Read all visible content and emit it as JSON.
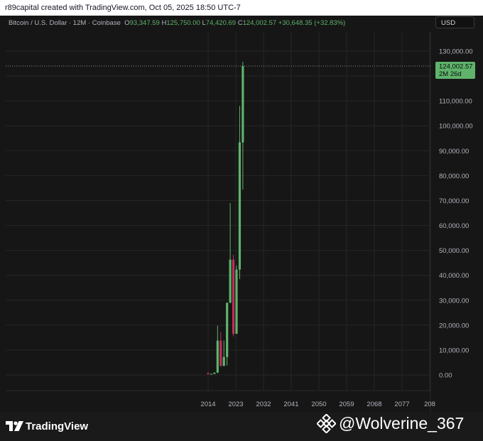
{
  "header": {
    "caption": "r89capital created with TradingView.com, Oct 05, 2025 18:50 UTC-7"
  },
  "legend": {
    "symbol": "Bitcoin / U.S. Dollar · 12M · Coinbase",
    "o_label": "O",
    "o_value": "93,347.59",
    "h_label": "H",
    "h_value": "125,750.00",
    "l_label": "L",
    "l_value": "74,420.69",
    "c_label": "C",
    "c_value": "124,002.57",
    "change": "+30,648.35 (+32.83%)"
  },
  "currency_button": "USD",
  "price_tag": {
    "price": "124,002.57",
    "countdown": "2M 26d"
  },
  "colors": {
    "up": "#5fb36b",
    "down": "#c02f5d",
    "tag_bg": "#5fb36b",
    "grid": "#262626"
  },
  "chart_data": {
    "type": "candlestick",
    "title": "Bitcoin / U.S. Dollar · 12M · Coinbase",
    "y_ticks": [
      "130,000.00",
      "110,000.00",
      "100,000.00",
      "90,000.00",
      "80,000.00",
      "70,000.00",
      "60,000.00",
      "50,000.00",
      "40,000.00",
      "30,000.00",
      "20,000.00",
      "10,000.00",
      "0.00"
    ],
    "x_ticks": [
      "2014",
      "2023",
      "2032",
      "2041",
      "2050",
      "2059",
      "2068",
      "2077",
      "208"
    ],
    "ylim": [
      -8000,
      140000
    ],
    "candles": [
      {
        "year": 2014,
        "open": 750,
        "high": 1000,
        "low": 170,
        "close": 320
      },
      {
        "year": 2015,
        "open": 320,
        "high": 500,
        "low": 170,
        "close": 430
      },
      {
        "year": 2016,
        "open": 430,
        "high": 980,
        "low": 360,
        "close": 960
      },
      {
        "year": 2017,
        "open": 960,
        "high": 19800,
        "low": 750,
        "close": 13800
      },
      {
        "year": 2018,
        "open": 13800,
        "high": 17200,
        "low": 3200,
        "close": 3700
      },
      {
        "year": 2019,
        "open": 3700,
        "high": 13800,
        "low": 3400,
        "close": 7200
      },
      {
        "year": 2020,
        "open": 7200,
        "high": 29000,
        "low": 3800,
        "close": 29000
      },
      {
        "year": 2021,
        "open": 29000,
        "high": 69000,
        "low": 28800,
        "close": 46300
      },
      {
        "year": 2022,
        "open": 46300,
        "high": 48200,
        "low": 15500,
        "close": 16500
      },
      {
        "year": 2023,
        "open": 16500,
        "high": 44000,
        "low": 16500,
        "close": 42300
      },
      {
        "year": 2024,
        "open": 42300,
        "high": 108000,
        "low": 38500,
        "close": 93400
      },
      {
        "year": 2025,
        "open": 93347.59,
        "high": 125750.0,
        "low": 74420.69,
        "close": 124002.57
      }
    ]
  },
  "brand": {
    "name": "TradingView"
  },
  "watermark": {
    "text": "@Wolverine_367"
  }
}
